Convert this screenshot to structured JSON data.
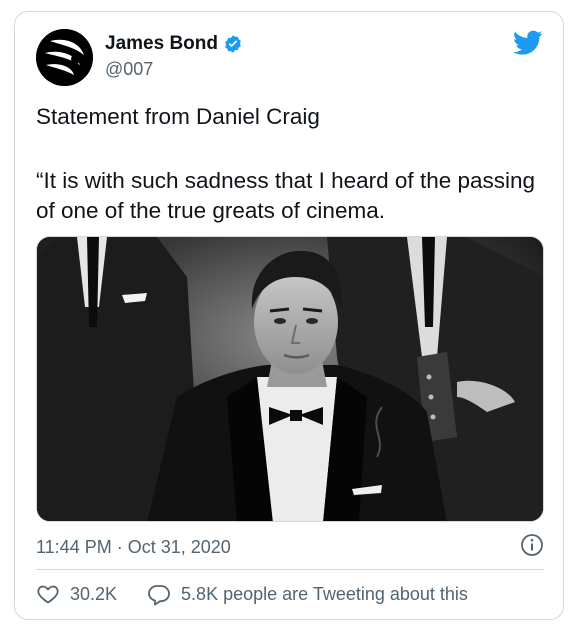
{
  "author": {
    "name": "James Bond",
    "handle": "@007",
    "verified_icon": "verified-badge-icon"
  },
  "brand": {
    "icon": "twitter-bird-icon",
    "color": "#1d9bf0"
  },
  "tweet": {
    "line1": "Statement from Daniel Craig",
    "line2": "“It is with such sadness that I heard of the passing of one of the true greats of cinema.",
    "media_alt": "Black and white photo of a man in a tuxedo and bow tie"
  },
  "meta": {
    "timestamp": "11:44 PM · Oct 31, 2020",
    "info_icon": "info-icon"
  },
  "actions": {
    "likes": "30.2K",
    "like_icon": "heart-icon",
    "conversation": "5.8K people are Tweeting about this",
    "conversation_icon": "reply-bubble-icon"
  }
}
